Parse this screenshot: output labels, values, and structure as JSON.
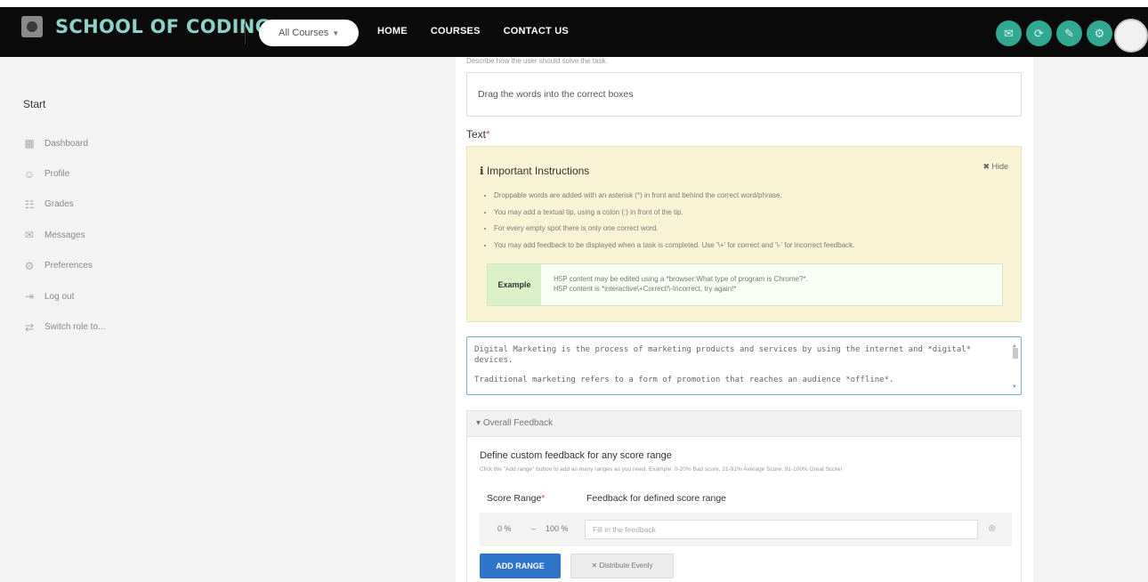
{
  "header": {
    "logo_text": "SCHOOL OF CODING",
    "courses_select": "All Courses",
    "nav": [
      "HOME",
      "COURSES",
      "CONTACT US"
    ]
  },
  "sidebar": {
    "start_label": "Start",
    "items": [
      {
        "label": "Dashboard",
        "icon": "dashboard-icon"
      },
      {
        "label": "Profile",
        "icon": "profile-icon"
      },
      {
        "label": "Grades",
        "icon": "grades-icon"
      },
      {
        "label": "Messages",
        "icon": "messages-icon"
      },
      {
        "label": "Preferences",
        "icon": "preferences-icon"
      },
      {
        "label": "Log out",
        "icon": "logout-icon"
      },
      {
        "label": "Switch role to...",
        "icon": "switch-role-icon"
      }
    ]
  },
  "form": {
    "description_hint": "Describe how the user should solve the task.",
    "description_value": "Drag the words into the correct boxes",
    "text_label": "Text",
    "instructions": {
      "title": "Important Instructions",
      "hide_label": "Hide",
      "items": [
        "Droppable words are added with an asterisk (*) in front and behind the correct word/phrase.",
        "You may add a textual tip, using a colon (:) in front of the tip.",
        "For every empty spot there is only one correct word.",
        "You may add feedback to be displayed when a task is completed. Use '\\+' for correct and '\\-' for incorrect feedback."
      ],
      "example_label": "Example",
      "example_lines": [
        "H5P content may be edited using a *browser:What type of program is Chrome?*.",
        "H5P content is *interactive\\+Correct!\\-Incorrect, try again!*"
      ]
    },
    "textarea_lines": [
      "Digital Marketing is the process of marketing products and services by using the internet and *digital* devices.",
      "Traditional marketing refers to a form of promotion that reaches an audience *offline*."
    ]
  },
  "feedback": {
    "header": "Overall Feedback",
    "title": "Define custom feedback for any score range",
    "hint": "Click the \"Add range\" button to add as many ranges as you need. Example: 0-20% Bad score, 21-91% Average Score, 91-100% Great Score!",
    "col_range": "Score Range",
    "col_feedback": "Feedback for defined score range",
    "range_from": "0 %",
    "range_to": "100 %",
    "feedback_placeholder": "Fill in the feedback",
    "add_range": "ADD RANGE",
    "distribute": "Distribute Evenly"
  },
  "colors": {
    "topbar": "#0b0b0b",
    "logo": "#8ed1c7",
    "icon_teal": "#32a893",
    "instructions_bg": "#f8f3d4",
    "primary_button": "#2e74c9"
  }
}
